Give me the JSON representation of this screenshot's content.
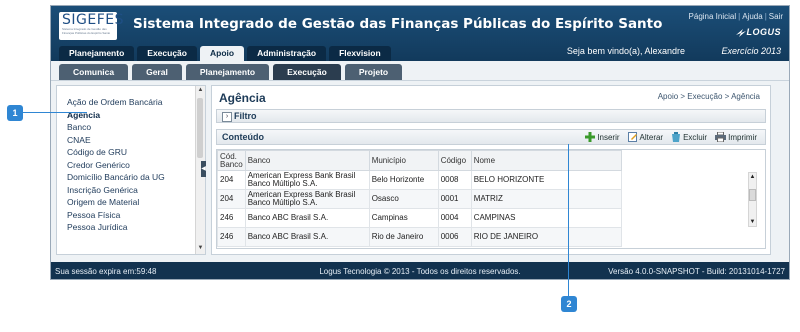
{
  "header": {
    "logo_text": "SIGEFES",
    "logo_tagline": "Sistema Integrado de Gestão das Finanças Públicas do Espírito Santo",
    "system_title": "Sistema Integrado de Gestão das Finanças Públicas do Espírito Santo",
    "links": [
      "Página Inicial",
      "Ajuda",
      "Sair"
    ],
    "brand": "LOGUS",
    "welcome": "Seja bem vindo(a), Alexandre",
    "year": "Exercício 2013"
  },
  "main_nav": [
    "Planejamento",
    "Execução",
    "Apoio",
    "Administração",
    "Flexvision"
  ],
  "main_nav_active": "Apoio",
  "sub_nav": [
    "Comunica",
    "Geral",
    "Planejamento",
    "Execução",
    "Projeto"
  ],
  "sub_nav_active": "Execução",
  "sidebar": {
    "items": [
      "Ação de Ordem Bancária",
      "Agência",
      "Banco",
      "CNAE",
      "Código de GRU",
      "Credor Genérico",
      "Domicílio Bancário da UG",
      "Inscrição Genérica",
      "Origem de Material",
      "Pessoa Física",
      "Pessoa Jurídica"
    ],
    "active": "Agência"
  },
  "page": {
    "title": "Agência",
    "breadcrumb": "Apoio > Execução > Agência",
    "filter_label": "Filtro",
    "content_label": "Conteúdo",
    "actions": [
      {
        "label": "Inserir",
        "icon": "plus-icon"
      },
      {
        "label": "Alterar",
        "icon": "edit-icon"
      },
      {
        "label": "Excluir",
        "icon": "delete-icon"
      },
      {
        "label": "Imprimir",
        "icon": "print-icon"
      }
    ]
  },
  "table": {
    "columns": [
      "Cód. Banco",
      "Banco",
      "Município",
      "Código",
      "Nome"
    ],
    "rows": [
      [
        "204",
        "American Express Bank Brasil Banco Múltiplo S.A.",
        "Belo Horizonte",
        "0008",
        "BELO HORIZONTE"
      ],
      [
        "204",
        "American Express Bank Brasil Banco Múltiplo S.A.",
        "Osasco",
        "0001",
        "MATRIZ"
      ],
      [
        "246",
        "Banco ABC Brasil S.A.",
        "Campinas",
        "0004",
        "CAMPINAS"
      ],
      [
        "246",
        "Banco ABC Brasil S.A.",
        "Rio de Janeiro",
        "0006",
        "RIO DE JANEIRO"
      ]
    ]
  },
  "footer": {
    "session": "Sua sessão expira em:59:48",
    "copyright": "Logus Tecnologia © 2013 - Todos os direitos reservados.",
    "version": "Versão 4.0.0-SNAPSHOT - Build: 20131014-1727"
  },
  "callouts": [
    "1",
    "2"
  ],
  "colors": {
    "header": "#1b4e78",
    "footer": "#12324f",
    "callout": "#2f86d3"
  }
}
